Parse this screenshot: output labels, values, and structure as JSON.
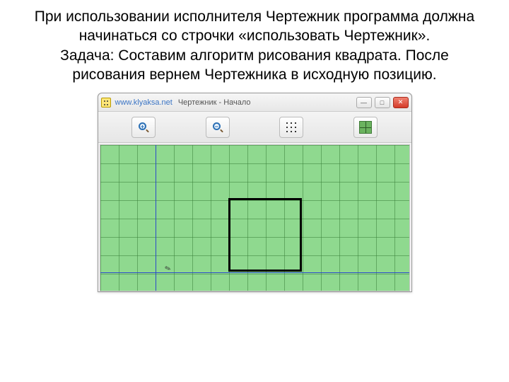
{
  "slide": {
    "p1": "При использовании исполнителя Чертежник программа должна начинаться со строчки «использовать Чертежник».",
    "p2": "Задача: Составим алгоритм рисования квадрата. После рисования вернем Чертежника в исходную позицию."
  },
  "window": {
    "site": "www.klyaksa.net",
    "title": "Чертежник - Начало",
    "minimize": "—",
    "maximize": "□",
    "close": "✕"
  },
  "toolbar": {
    "zoom_in": "+",
    "zoom_out": "−"
  },
  "canvas": {
    "cell": 26,
    "axis_x_col": 3,
    "axis_y_row_from_bottom": 1,
    "square": {
      "col": 7,
      "row_from_bottom": 1,
      "w": 4,
      "h": 4
    }
  }
}
